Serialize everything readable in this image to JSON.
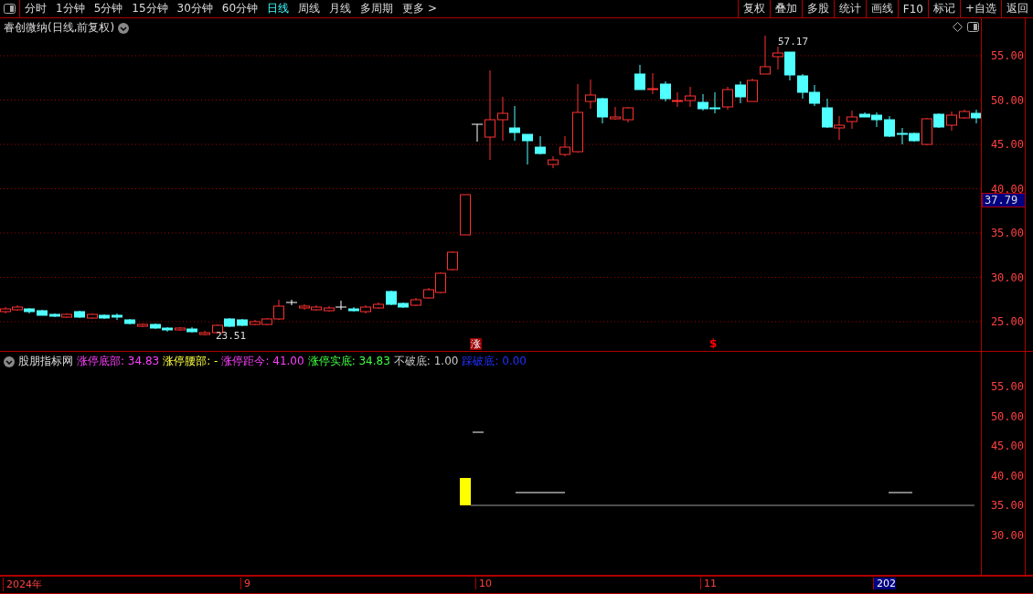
{
  "toolbar": {
    "periods": [
      {
        "label": "分时",
        "selected": false
      },
      {
        "label": "1分钟",
        "selected": false
      },
      {
        "label": "5分钟",
        "selected": false
      },
      {
        "label": "15分钟",
        "selected": false
      },
      {
        "label": "30分钟",
        "selected": false
      },
      {
        "label": "60分钟",
        "selected": false
      },
      {
        "label": "日线",
        "selected": true
      },
      {
        "label": "周线",
        "selected": false
      },
      {
        "label": "月线",
        "selected": false
      },
      {
        "label": "多周期",
        "selected": false
      },
      {
        "label": "更多 >",
        "selected": false
      }
    ],
    "actions": [
      "复权",
      "叠加",
      "多股",
      "统计",
      "画线",
      "F10",
      "标记",
      "+自选",
      "返回"
    ]
  },
  "main_chart": {
    "title": "睿创微纳(日线,前复权)",
    "high_label": "57.17",
    "low_label": "23.51",
    "limit_up_marker": "涨",
    "signal_marker": "$",
    "axis_ticks": [
      "55.00",
      "50.00",
      "45.00",
      "40.00",
      "35.00",
      "30.00",
      "25.00"
    ],
    "current_price": "37.79"
  },
  "indicator": {
    "name": "股朋指标网",
    "legend": [
      {
        "text": "涨停底部: 34.83",
        "color": "#ff40ff"
      },
      {
        "text": "涨停腰部: -",
        "color": "#ffff40"
      },
      {
        "text": "涨停距今: 41.00",
        "color": "#ff40ff"
      },
      {
        "text": "涨停实底: 34.83",
        "color": "#40ff40"
      },
      {
        "text": "不破底: 1.00",
        "color": "#c8c8c8"
      },
      {
        "text": "踩破底: 0.00",
        "color": "#2030ff"
      }
    ],
    "axis_ticks": [
      "55.00",
      "50.00",
      "45.00",
      "40.00",
      "35.00",
      "30.00"
    ]
  },
  "date_axis": [
    {
      "label": "2024年",
      "highlighted": false
    },
    {
      "label": "9",
      "highlighted": false
    },
    {
      "label": "10",
      "highlighted": false
    },
    {
      "label": "11",
      "highlighted": false
    },
    {
      "label": "202",
      "highlighted": true
    }
  ]
}
